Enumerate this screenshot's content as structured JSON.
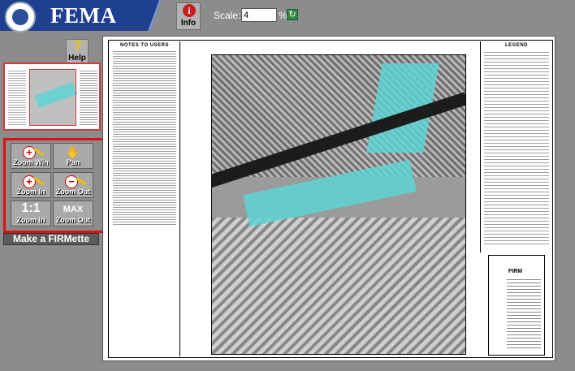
{
  "header": {
    "brand": "FEMA",
    "info_label": "Info",
    "info_glyph": "i",
    "scale_label": "Scale:",
    "scale_value": "4",
    "percent_sign": "%"
  },
  "sidebar": {
    "help_label": "Help",
    "help_glyph": "?",
    "tools": {
      "zoom_win": "Zoom Win",
      "pan": "Pan",
      "zoom_in": "Zoom In",
      "zoom_out": "Zoom Out",
      "one_to_one_glyph": "1:1",
      "one_to_one_label": "Zoom In",
      "max_glyph": "MAX",
      "max_label": "Zoom Out"
    },
    "firmette_label": "Make a FIRMette"
  },
  "document": {
    "notes_title": "NOTES TO USERS",
    "legend_title": "LEGEND",
    "titleblock_heading": "FIRM"
  },
  "colors": {
    "brand_blue": "#1f3f8f",
    "highlight_red": "#e01010",
    "flood_cyan": "#5fd3d3"
  }
}
